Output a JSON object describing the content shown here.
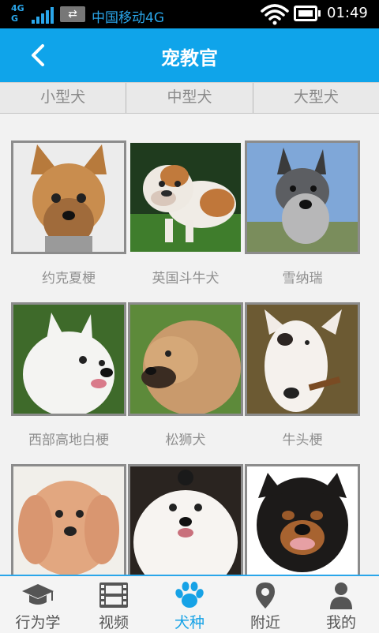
{
  "status_bar": {
    "network_top": "4G",
    "network_bottom": "G",
    "carrier": "中国移动4G",
    "time": "01:49",
    "icons": [
      "signal-bars-icon",
      "data-transfer-icon",
      "wifi-icon",
      "battery-icon"
    ]
  },
  "header": {
    "title": "宠教官",
    "back_icon": "chevron-left-icon"
  },
  "tabs": [
    {
      "label": "小型犬"
    },
    {
      "label": "中型犬"
    },
    {
      "label": "大型犬"
    }
  ],
  "breeds": [
    {
      "name": "约克夏梗"
    },
    {
      "name": "英国斗牛犬"
    },
    {
      "name": "雪纳瑞"
    },
    {
      "name": "西部高地白梗"
    },
    {
      "name": "松狮犬"
    },
    {
      "name": "牛头梗"
    },
    {
      "name": ""
    },
    {
      "name": ""
    },
    {
      "name": ""
    }
  ],
  "bottom_nav": {
    "active_index": 2,
    "items": [
      {
        "label": "行为学",
        "icon": "graduation-cap-icon"
      },
      {
        "label": "视频",
        "icon": "film-icon"
      },
      {
        "label": "犬种",
        "icon": "paw-icon"
      },
      {
        "label": "附近",
        "icon": "location-pin-icon"
      },
      {
        "label": "我的",
        "icon": "user-icon"
      }
    ]
  },
  "colors": {
    "accent": "#0fa4ea",
    "active_nav": "#16a2e6",
    "inactive_nav": "#555555",
    "status_blue": "#2aa6ea"
  }
}
